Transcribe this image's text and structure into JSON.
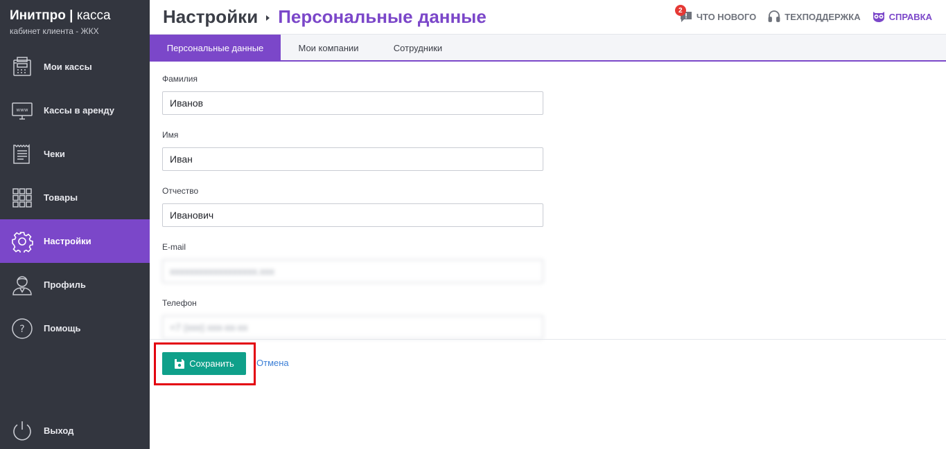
{
  "brand": {
    "name": "Инитпро",
    "separator": "|",
    "product": "касса",
    "subtitle": "кабинет клиента - ЖКХ"
  },
  "sidebar": {
    "items": [
      {
        "label": "Мои кассы",
        "icon": "cash-register-icon"
      },
      {
        "label": "Кассы в аренду",
        "icon": "www-monitor-icon"
      },
      {
        "label": "Чеки",
        "icon": "receipt-icon"
      },
      {
        "label": "Товары",
        "icon": "grid-icon"
      },
      {
        "label": "Настройки",
        "icon": "gear-icon",
        "active": true
      },
      {
        "label": "Профиль",
        "icon": "user-icon"
      },
      {
        "label": "Помощь",
        "icon": "help-icon"
      }
    ],
    "logout": {
      "label": "Выход",
      "icon": "power-icon"
    }
  },
  "header": {
    "breadcrumb_root": "Настройки",
    "breadcrumb_current": "Персональные данные",
    "links": {
      "whats_new": {
        "label": "ЧТО НОВОГО",
        "badge": "2",
        "icon": "chat-alert-icon"
      },
      "support": {
        "label": "ТЕХПОДДЕРЖКА",
        "icon": "headset-icon"
      },
      "help": {
        "label": "СПРАВКА",
        "icon": "owl-icon"
      }
    }
  },
  "tabs": [
    {
      "label": "Персональные данные",
      "active": true
    },
    {
      "label": "Мои компании"
    },
    {
      "label": "Сотрудники"
    }
  ],
  "form": {
    "last_name": {
      "label": "Фамилия",
      "value": "Иванов"
    },
    "first_name": {
      "label": "Имя",
      "value": "Иван"
    },
    "middle_name": {
      "label": "Отчество",
      "value": "Иванович"
    },
    "email": {
      "label": "E-mail",
      "value": "xxxxxxxxxxxxxxxxxx.xxx"
    },
    "phone": {
      "label": "Телефон",
      "value": "+7 (xxx) xxx-xx-xx"
    }
  },
  "actions": {
    "save_label": "Сохранить",
    "cancel_label": "Отмена"
  },
  "colors": {
    "sidebar_bg": "#33363f",
    "accent": "#7b47c9",
    "save": "#0fa08a",
    "highlight": "#e3000f",
    "link": "#3c7fd6"
  }
}
